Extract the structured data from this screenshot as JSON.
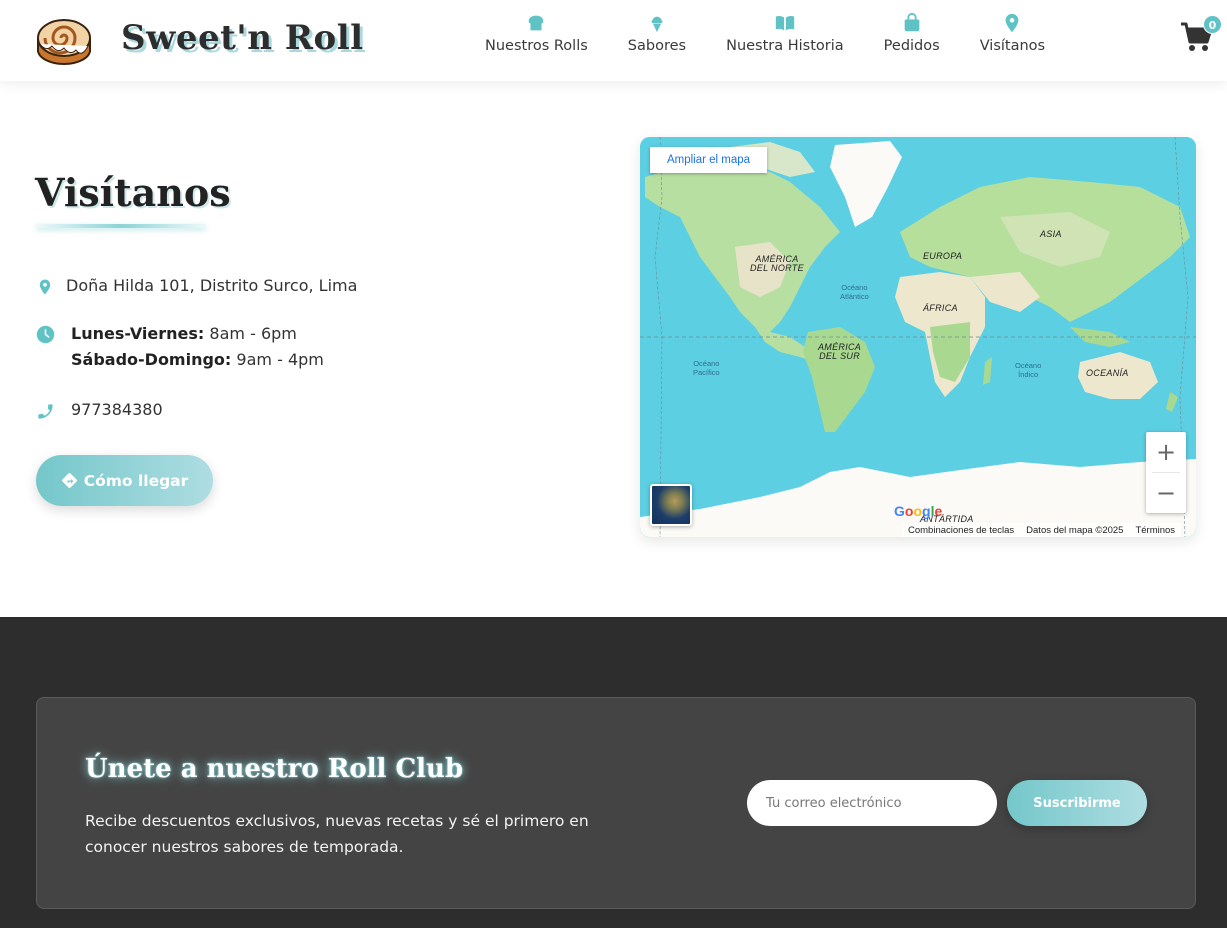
{
  "header": {
    "brand": "Sweet'n Roll",
    "logo_icon": "cinnamon-roll-logo",
    "nav": [
      {
        "label": "Nuestros Rolls",
        "icon": "bread-icon"
      },
      {
        "label": "Sabores",
        "icon": "ice-cream-icon"
      },
      {
        "label": "Nuestra Historia",
        "icon": "book-icon"
      },
      {
        "label": "Pedidos",
        "icon": "shopping-bag-icon"
      },
      {
        "label": "Visítanos",
        "icon": "location-pin-icon"
      }
    ],
    "cart_count": "0",
    "accent_color": "#5fc3c5"
  },
  "visit": {
    "title": "Visítanos",
    "address": "Doña Hilda 101, Distrito Surco, Lima",
    "hours": [
      {
        "days": "Lunes-Viernes:",
        "time": "8am - 6pm"
      },
      {
        "days": "Sábado-Domingo:",
        "time": "9am - 4pm"
      }
    ],
    "phone": "977384380",
    "directions_label": "Cómo llegar"
  },
  "map": {
    "enlarge_label": "Ampliar el mapa",
    "zoom_in": "+",
    "zoom_out": "−",
    "google": "Google",
    "footer": [
      "Combinaciones de teclas",
      "Datos del mapa ©2025",
      "Términos"
    ],
    "labels": {
      "north_america": "AMÉRICA\nDEL NORTE",
      "europe": "EUROPA",
      "asia": "ASIA",
      "atlantic": "Océano\nAtlántico",
      "africa": "ÁFRICA",
      "south_america": "AMÉRICA\nDEL SUR",
      "pacific": "Océano\nPacífico",
      "indian": "Océano\nÍndico",
      "oceania": "OCEANÍA",
      "antarctica": "ANTÁRTIDA"
    }
  },
  "newsletter": {
    "title": "Únete a nuestro Roll Club",
    "description": "Recibe descuentos exclusivos, nuevas recetas y sé el primero en conocer nuestros sabores de temporada.",
    "email_placeholder": "Tu correo electrónico",
    "subscribe_label": "Suscribirme"
  }
}
